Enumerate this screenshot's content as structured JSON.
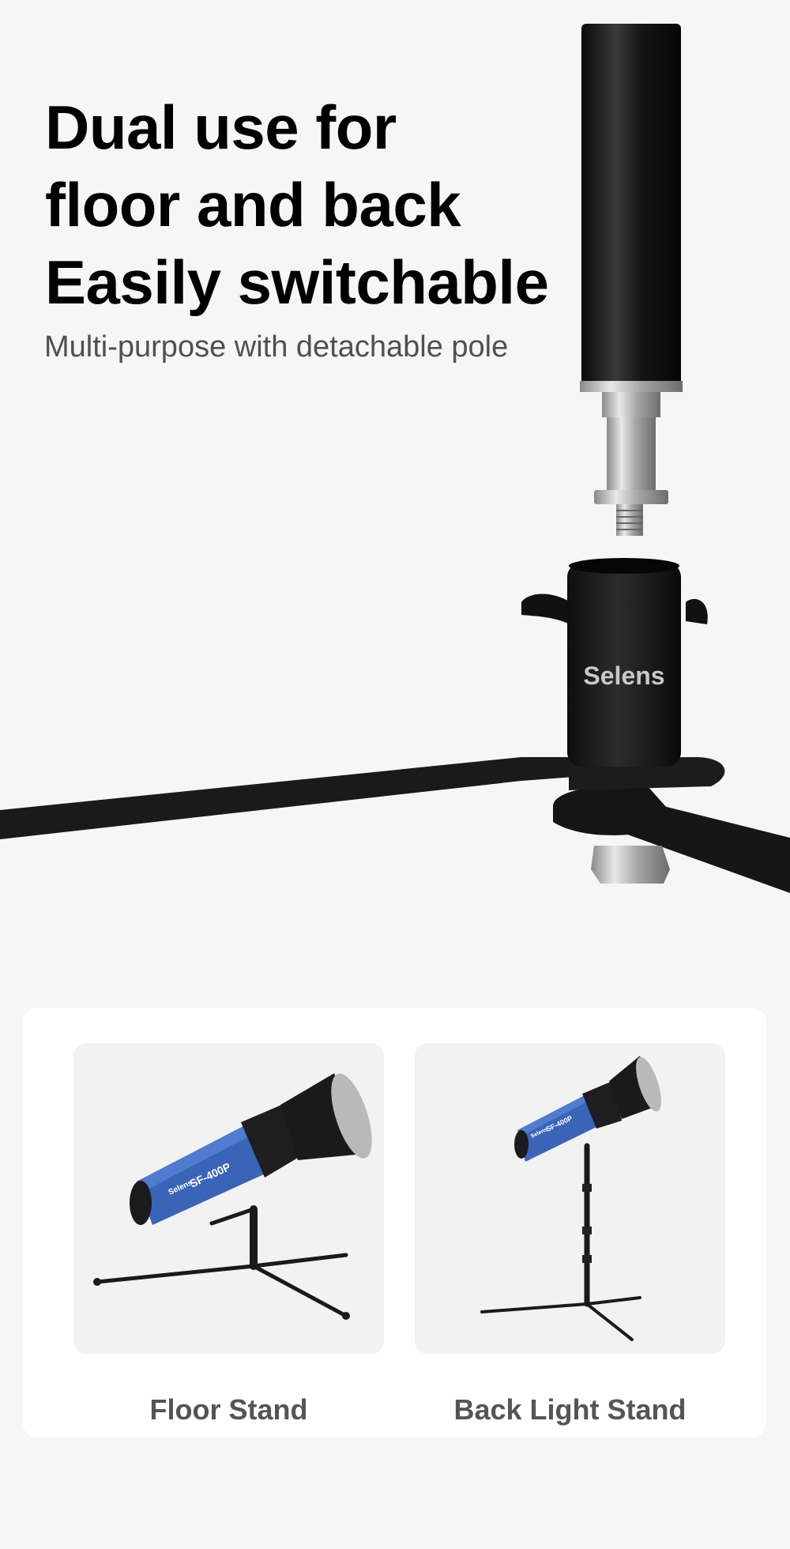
{
  "headline": {
    "line1": "Dual use for",
    "line2": "floor and back",
    "line3": "Easily switchable"
  },
  "subheadline": "Multi-purpose with detachable pole",
  "product_image": {
    "brand_logo": "Selens"
  },
  "usage_modes": [
    {
      "label": "Floor Stand",
      "light_model": "SF-400P",
      "light_brand": "Selens"
    },
    {
      "label": "Back Light Stand",
      "light_model": "SF-400P",
      "light_brand": "Selens"
    }
  ]
}
